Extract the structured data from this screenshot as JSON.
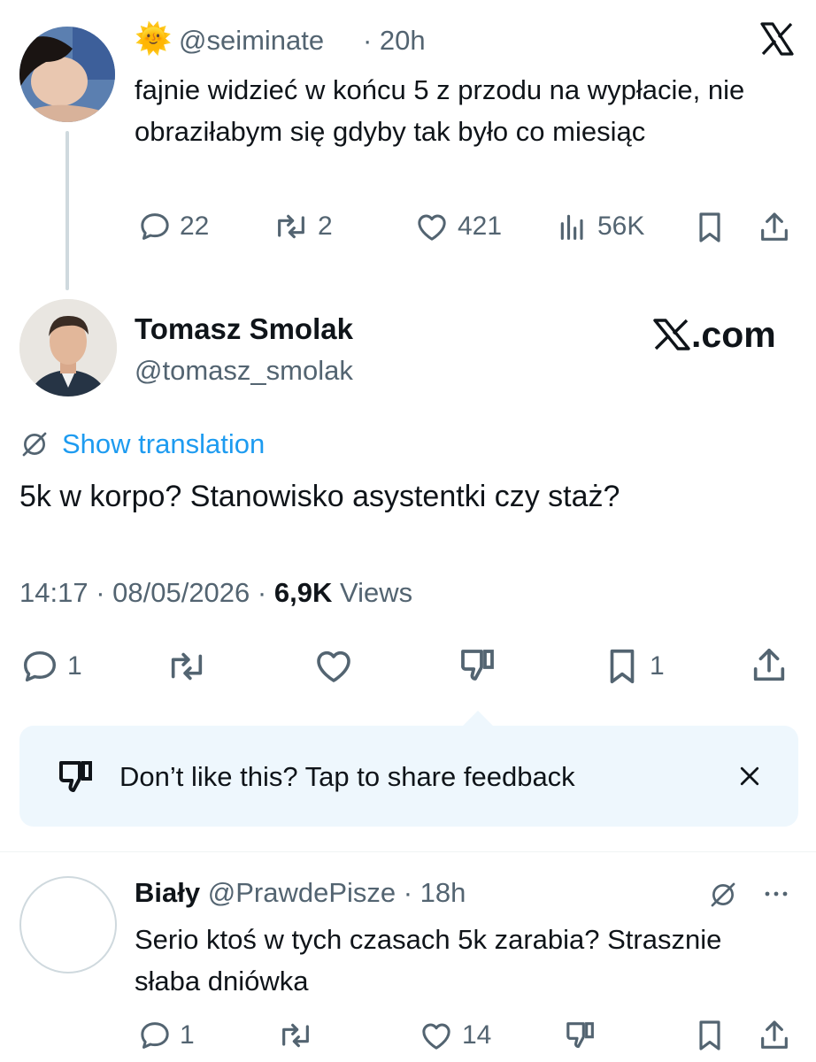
{
  "parent_tweet": {
    "emoji": "🌞",
    "handle": "@seiminate",
    "time": "· 20h",
    "text": "fajnie widzieć w końcu 5 z przodu na wypłacie, nie obraziłabym się gdyby tak było co miesiąc",
    "stats": {
      "replies": "22",
      "retweets": "2",
      "likes": "421",
      "views": "56K"
    }
  },
  "main_tweet": {
    "name": "Tomasz Smolak",
    "handle": "@tomasz_smolak",
    "brand": ".com",
    "show_translation": "Show translation",
    "text": "5k w korpo? Stanowisko asystentki czy staż?",
    "date": "14:17 · 08/05/2026 ·",
    "views_count": "6,9K",
    "views_label": "Views",
    "stats": {
      "replies": "1",
      "bookmarks": "1"
    }
  },
  "feedback": {
    "text": "Don’t like this? Tap to share feedback"
  },
  "reply_tweet": {
    "name": "Biały",
    "handle": "@PrawdePisze",
    "time": "· 18h",
    "text": "Serio ktoś w tych czasach 5k zarabia? Strasznie słaba dniówka",
    "stats": {
      "replies": "1",
      "likes": "14"
    }
  },
  "colors": {
    "link": "#1d9bf0",
    "secondary": "#536471",
    "feedback_bg": "#eef7fd"
  }
}
